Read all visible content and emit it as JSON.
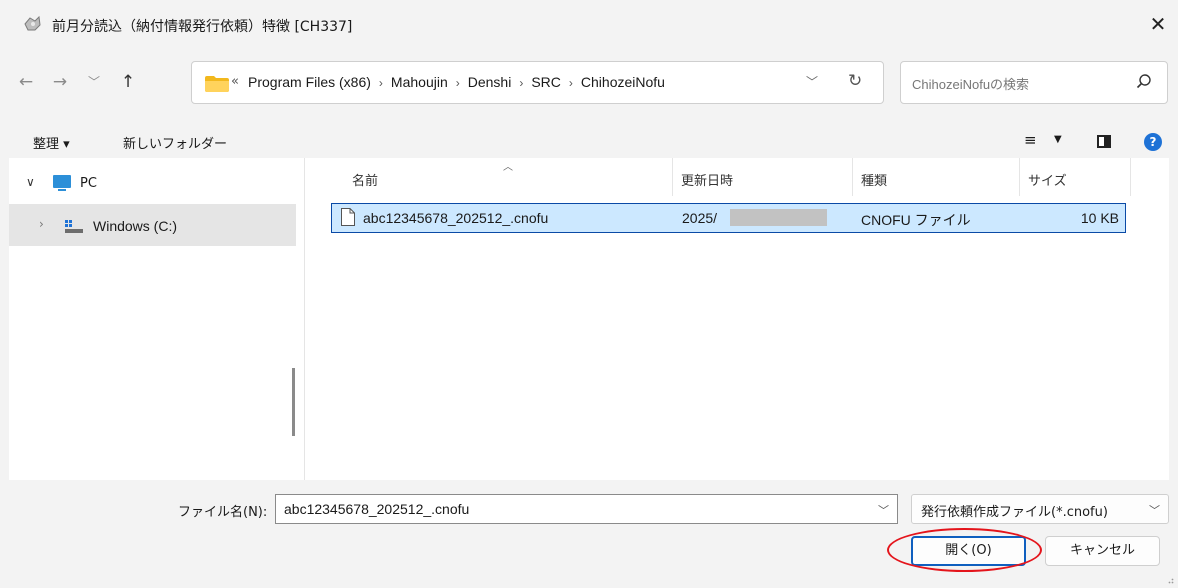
{
  "window": {
    "title": "前月分読込（納付情報発行依頼）特徴 [CH337]",
    "close": "✕"
  },
  "nav": {
    "back": "←",
    "forward": "→",
    "recent": "﹀",
    "up": "↑"
  },
  "address": {
    "prefix": "«",
    "crumbs": [
      "Program Files (x86)",
      "Mahoujin",
      "Denshi",
      "SRC",
      "ChihozeiNofu"
    ],
    "separator": "›",
    "dropdown": "﹀",
    "refresh": "↻"
  },
  "search": {
    "placeholder": "ChihozeiNofuの検索"
  },
  "toolbar": {
    "organize": "整理 ▾",
    "new_folder": "新しいフォルダー",
    "view_icon": "≡",
    "view_caret": "▼",
    "help": "?"
  },
  "tree": {
    "pc_caret": "∨",
    "pc_label": "PC",
    "drive_caret": "›",
    "drive_label": "Windows (C:)"
  },
  "columns": {
    "name": "名前",
    "modified": "更新日時",
    "type": "種類",
    "size": "サイズ",
    "sort_indicator": "︿"
  },
  "files": [
    {
      "name": "abc12345678_202512_.cnofu",
      "modified": "2025/",
      "type": "CNOFU ファイル",
      "size": "10 KB"
    }
  ],
  "footer": {
    "filename_label": "ファイル名(N):",
    "filename_value": "abc12345678_202512_.cnofu",
    "filetype_value": "発行依頼作成ファイル(*.cnofu)",
    "dropdown": "﹀",
    "open_label": "開く(O)",
    "cancel_label": "キャンセル"
  },
  "colors": {
    "selection_bg": "#cce8ff",
    "selection_border": "#0a4aa6",
    "accent": "#0f5fbf",
    "annotation": "#e4141b"
  }
}
